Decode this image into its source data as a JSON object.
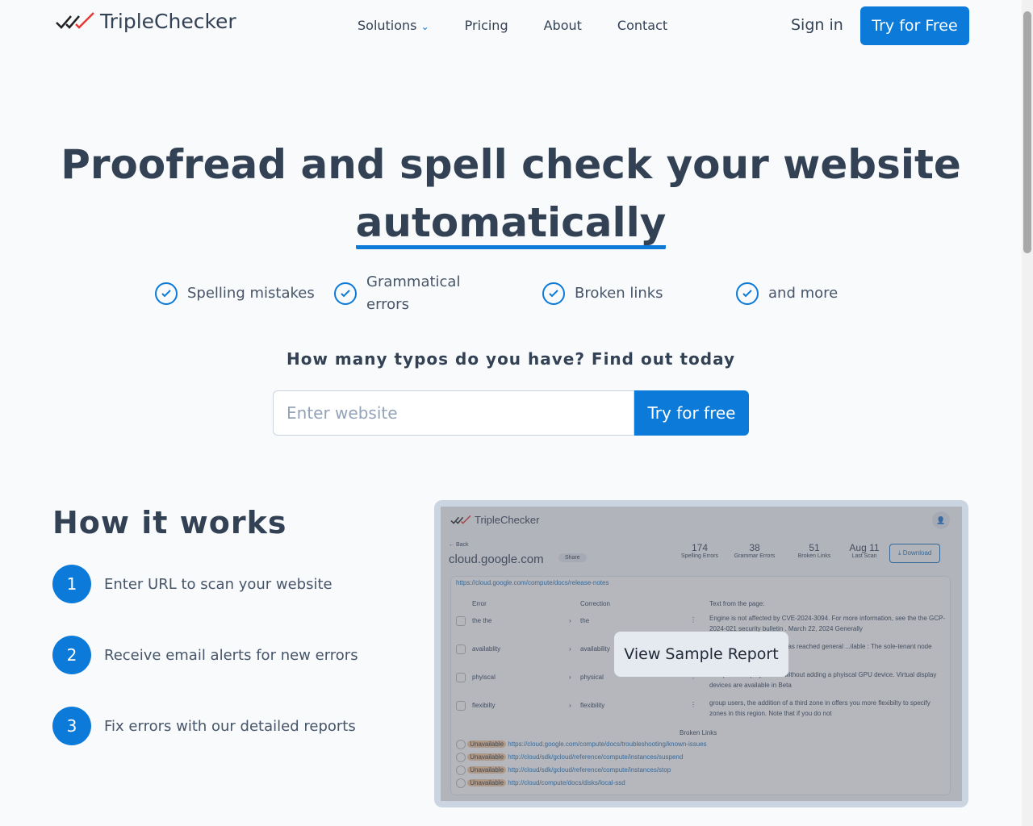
{
  "nav": {
    "brand": "TripleChecker",
    "links": [
      "Solutions",
      "Pricing",
      "About",
      "Contact"
    ],
    "sign_in": "Sign in",
    "try_free": "Try for Free"
  },
  "hero": {
    "title_line1": "Proofread and spell check your website",
    "title_line2": "automatically",
    "features": [
      "Spelling mistakes",
      "Grammatical errors",
      "Broken links",
      "and more"
    ],
    "subtitle": "How many typos do you have? Find out today",
    "input_placeholder": "Enter website",
    "cta": "Try for free"
  },
  "how": {
    "title": "How it works",
    "steps": [
      {
        "n": "1",
        "text": "Enter URL to scan your website"
      },
      {
        "n": "2",
        "text": "Receive email alerts for new errors"
      },
      {
        "n": "3",
        "text": "Fix errors with our detailed reports"
      }
    ]
  },
  "sample": {
    "brand": "TripleChecker",
    "back": "← Back",
    "site": "cloud.google.com",
    "share": "Share",
    "stats": [
      {
        "v": "174",
        "l": "Spelling Errors"
      },
      {
        "v": "38",
        "l": "Grammar Errors"
      },
      {
        "v": "51",
        "l": "Broken Links"
      },
      {
        "v": "Aug 11",
        "l": "Last Scan"
      }
    ],
    "download": "Download",
    "page_url": "https://cloud.google.com/compute/docs/release-notes",
    "col_error": "Error",
    "col_correction": "Correction",
    "col_text": "Text from the page:",
    "rows": [
      {
        "e": "the the",
        "c": "the",
        "t": "Engine is not affected by CVE-2024-3094. For more information, see the the GCP-2024-021 security bulletin . March 22, 2024 Generally"
      },
      {
        "e": "availablity",
        "c": "availability",
        "t": "...eneral purpose N2 VMs has reached general ...ilable : The sole-tenant node type"
      },
      {
        "e": "phyiscal",
        "c": "physical",
        "t": "...require a display device without adding a phyiscal GPU device. Virtual display devices are available in Beta"
      },
      {
        "e": "flexibilty",
        "c": "flexibility",
        "t": "group users, the addition of a third zone in offers you more flexibilty to specify zones in this region. Note that if you do not"
      }
    ],
    "broken_title": "Broken Links",
    "badge": "Unavailable",
    "links": [
      "https://cloud.google.com/compute/docs/troubleshooting/known-issues",
      "http://cloud/sdk/gcloud/reference/compute/instances/suspend",
      "http://cloud/sdk/gcloud/reference/compute/instances/stop",
      "http://cloud/compute/docs/disks/local-ssd"
    ],
    "view_button": "View Sample Report"
  },
  "colors": {
    "accent": "#0b7ad9",
    "text": "#334155",
    "background": "#f8fafc"
  }
}
